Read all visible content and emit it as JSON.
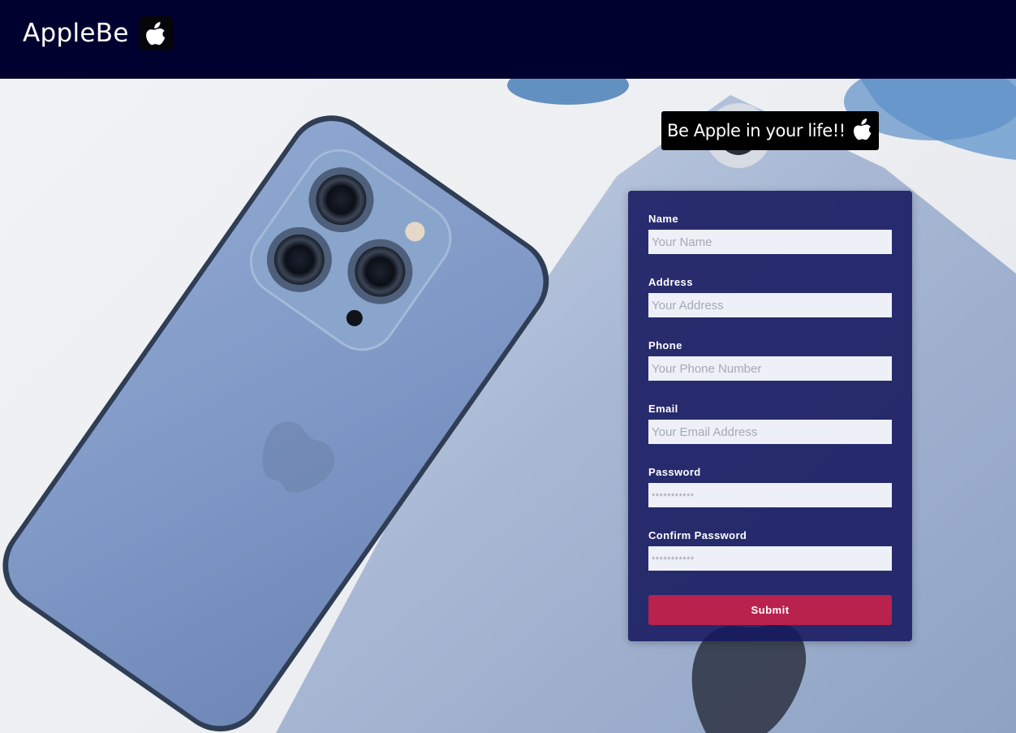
{
  "header": {
    "brand": "AppleBe",
    "logo_icon": "apple-logo-icon",
    "background_color": "#01012f"
  },
  "hero": {
    "tagline": "Be Apple in your life!!",
    "tagline_icon": "apple-logo-icon"
  },
  "form": {
    "fields": [
      {
        "label": "Name",
        "placeholder": "Your Name",
        "type": "text"
      },
      {
        "label": "Address",
        "placeholder": "Your Address",
        "type": "text"
      },
      {
        "label": "Phone",
        "placeholder": "Your Phone Number",
        "type": "tel"
      },
      {
        "label": "Email",
        "placeholder": "Your Email Address",
        "type": "email"
      },
      {
        "label": "Password",
        "placeholder": "***********",
        "type": "password"
      },
      {
        "label": "Confirm Password",
        "placeholder": "***********",
        "type": "password"
      }
    ],
    "submit_label": "Submit",
    "card_color": "#16185e",
    "submit_color": "#b8224d"
  }
}
